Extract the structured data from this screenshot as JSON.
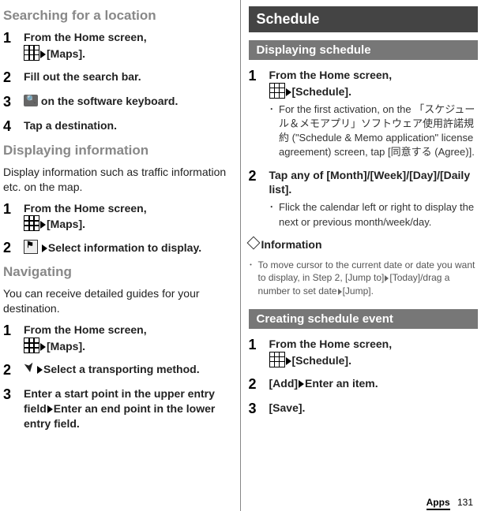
{
  "left": {
    "searching_heading": "Searching for a location",
    "search_steps": [
      {
        "num": "1",
        "text_pre": "From the Home screen, ",
        "text_post": "[Maps].",
        "icon": "apps"
      },
      {
        "num": "2",
        "text": "Fill out the search bar."
      },
      {
        "num": "3",
        "text_post": " on the software keyboard.",
        "icon": "search"
      },
      {
        "num": "4",
        "text": "Tap a destination."
      }
    ],
    "display_heading": "Displaying information",
    "display_intro": "Display information such as traffic information etc. on the map.",
    "display_steps": [
      {
        "num": "1",
        "text_pre": "From the Home screen, ",
        "text_post": "[Maps].",
        "icon": "apps"
      },
      {
        "num": "2",
        "text_post": "Select information to display.",
        "icon": "info"
      }
    ],
    "nav_heading": "Navigating",
    "nav_intro": "You can receive detailed guides for your destination.",
    "nav_steps": [
      {
        "num": "1",
        "text_pre": "From the Home screen, ",
        "text_post": "[Maps].",
        "icon": "apps"
      },
      {
        "num": "2",
        "text_post": "Select a transporting method.",
        "icon": "nav"
      },
      {
        "num": "3",
        "text": "Enter a start point in the upper entry field",
        "text2": "Enter an end point in the lower entry field."
      }
    ]
  },
  "right": {
    "schedule_banner": "Schedule",
    "display_sched_sub": "Displaying schedule",
    "display_sched_steps": [
      {
        "num": "1",
        "text_pre": "From the Home screen, ",
        "text_post": "[Schedule].",
        "icon": "apps",
        "sub": "For the first activation, on the 「スケジュール＆メモアプリ」ソフトウェア使用許諾規約 (\"Schedule & Memo application\" license agreement) screen, tap [同意する (Agree)]."
      },
      {
        "num": "2",
        "text": "Tap any of [Month]/[Week]/[Day]/[Daily list].",
        "sub": "Flick the calendar left or right to display the next or previous month/week/day."
      }
    ],
    "info_heading": "Information",
    "info_bullet_pre": "To move cursor to the current date or date you want to display, in Step 2, [Jump to]",
    "info_bullet_mid": "[Today]/drag a number to set date",
    "info_bullet_post": "[Jump].",
    "create_sub": "Creating schedule event",
    "create_steps": [
      {
        "num": "1",
        "text_pre": "From the Home screen, ",
        "text_post": "[Schedule].",
        "icon": "apps"
      },
      {
        "num": "2",
        "text_pre": "[Add]",
        "text_post": "Enter an item."
      },
      {
        "num": "3",
        "text": "[Save]."
      }
    ]
  },
  "footer": {
    "apps": "Apps",
    "page": "131"
  }
}
